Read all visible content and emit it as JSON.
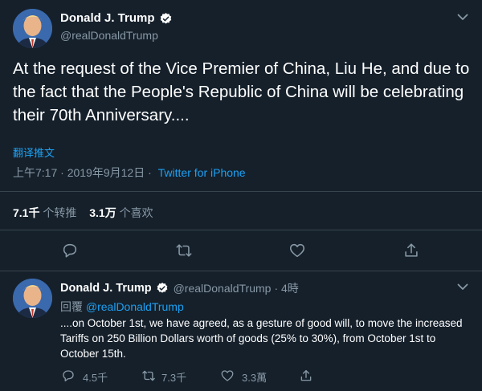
{
  "main_tweet": {
    "author": {
      "name": "Donald J. Trump",
      "handle": "@realDonaldTrump"
    },
    "text": "At the request of the Vice Premier of China, Liu He, and due to the fact that the People's Republic of China will be celebrating their 70th Anniversary....",
    "translate_label": "翻译推文",
    "timestamp": "上午7:17 · 2019年9月12日",
    "separator": "·",
    "source": "Twitter for iPhone",
    "stats": {
      "retweets_count": "7.1千",
      "retweets_label": "个转推",
      "likes_count": "3.1万",
      "likes_label": "个喜欢"
    }
  },
  "reply_tweet": {
    "author": {
      "name": "Donald J. Trump",
      "handle": "@realDonaldTrump",
      "time": "· 4時"
    },
    "replying_prefix": "回覆",
    "replying_to": "@realDonaldTrump",
    "text": "....on October 1st, we have agreed, as a gesture of good will, to move the increased Tariffs on 250 Billion Dollars worth of goods (25% to 30%), from October 1st to October 15th.",
    "counts": {
      "replies": "4.5千",
      "retweets": "7.3千",
      "likes": "3.3萬"
    }
  },
  "colors": {
    "background": "#15202b",
    "divider": "#38444d",
    "muted_text": "#8899a6",
    "accent": "#1da1f2",
    "text": "#ffffff"
  }
}
